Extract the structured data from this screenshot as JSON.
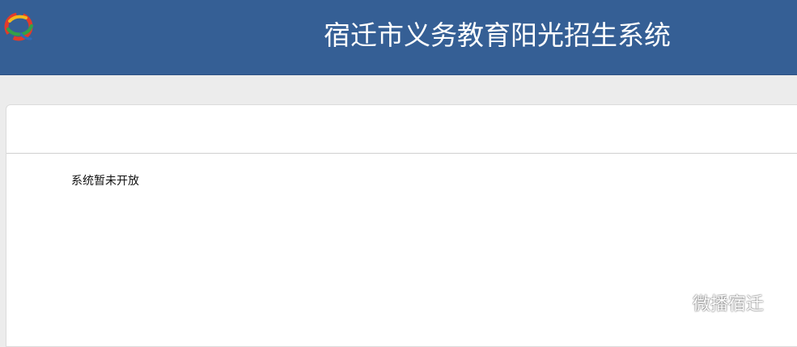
{
  "header": {
    "title": "宿迁市义务教育阳光招生系统",
    "logo_icon": "swirl-logo-icon",
    "background": "#355f95"
  },
  "panel": {
    "message": "系统暂未开放"
  },
  "watermark": {
    "text": "微播宿迁",
    "icon": "wechat-icon"
  }
}
